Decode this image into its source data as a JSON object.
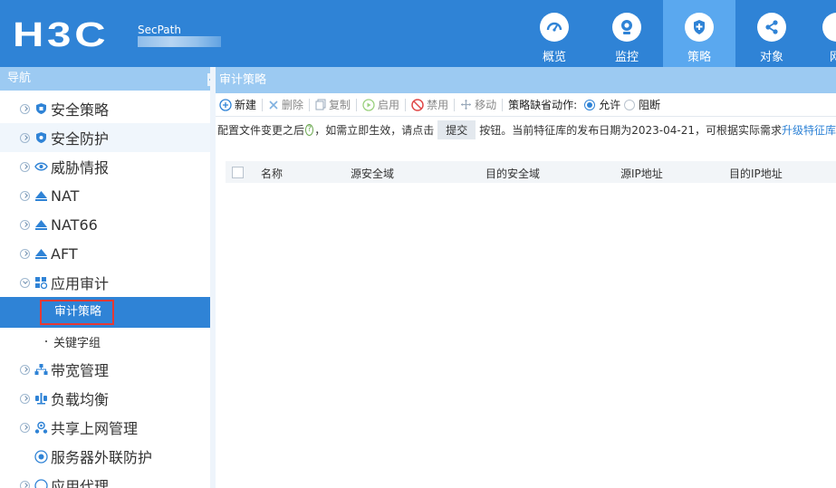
{
  "header": {
    "logo_text": "H3C",
    "product_name": "SecPath",
    "nav": [
      {
        "label": "概览",
        "icon": "dashboard-gauge-icon",
        "active": false
      },
      {
        "label": "监控",
        "icon": "monitor-camera-icon",
        "active": false
      },
      {
        "label": "策略",
        "icon": "policy-shield-icon",
        "active": true
      },
      {
        "label": "对象",
        "icon": "share-nodes-icon",
        "active": false
      },
      {
        "label": "网",
        "icon": "network-icon",
        "active": false
      }
    ]
  },
  "sidebar": {
    "title": "导航",
    "items": [
      {
        "label": "安全策略",
        "icon": "shield-icon"
      },
      {
        "label": "安全防护",
        "icon": "shield-icon"
      },
      {
        "label": "威胁情报",
        "icon": "eye-icon"
      },
      {
        "label": "NAT",
        "icon": "nat-icon"
      },
      {
        "label": "NAT66",
        "icon": "nat-icon"
      },
      {
        "label": "AFT",
        "icon": "nat-icon"
      },
      {
        "label": "应用审计",
        "icon": "app-audit-icon"
      },
      {
        "label": "审计策略"
      },
      {
        "label": "关键字组"
      },
      {
        "label": "带宽管理",
        "icon": "bandwidth-icon"
      },
      {
        "label": "负载均衡",
        "icon": "balance-icon"
      },
      {
        "label": "共享上网管理",
        "icon": "shared-access-icon"
      },
      {
        "label": "服务器外联防护",
        "icon": "server-protect-icon"
      },
      {
        "label": "应用代理",
        "icon": "proxy-icon"
      }
    ]
  },
  "main": {
    "title": "审计策略",
    "toolbar": {
      "new": "新建",
      "delete": "删除",
      "copy": "复制",
      "enable": "启用",
      "disable": "禁用",
      "move": "移动",
      "default_action_label": "策略缺省动作:",
      "allow": "允许",
      "block": "阻断",
      "selected_action": "allow"
    },
    "notice": {
      "before_help": "配置文件变更之后",
      "help_symbol": "?",
      "after_help": "，如需立即生效，请点击",
      "submit_label": "提交",
      "after_submit": "按钮。当前特征库的发布日期为2023-04-21，可根据实际需求",
      "link_text": "升级特征库"
    },
    "table": {
      "columns": [
        "名称",
        "源安全域",
        "目的安全域",
        "源IP地址",
        "目的IP地址"
      ]
    }
  }
}
